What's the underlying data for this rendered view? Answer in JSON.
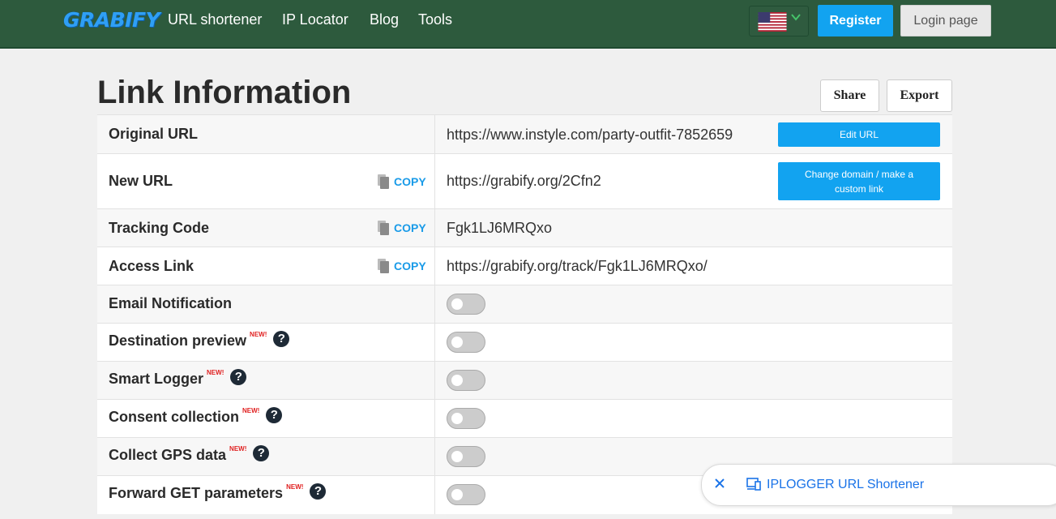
{
  "header": {
    "logo": "GRABIFY",
    "nav": [
      "URL shortener",
      "IP Locator",
      "Blog",
      "Tools"
    ],
    "language_icon": "us-flag-icon",
    "register_label": "Register",
    "login_label": "Login page"
  },
  "page": {
    "title": "Link Information",
    "share_label": "Share",
    "export_label": "Export"
  },
  "rows": [
    {
      "label": "Original URL",
      "value": "https://www.instyle.com/party-outfit-7852659",
      "action": "Edit URL"
    },
    {
      "label": "New URL",
      "copy": "COPY",
      "value": "https://grabify.org/2Cfn2",
      "action": "Change domain / make a custom link"
    },
    {
      "label": "Tracking Code",
      "copy": "COPY",
      "value": "Fgk1LJ6MRQxo"
    },
    {
      "label": "Access Link",
      "copy": "COPY",
      "value": "https://grabify.org/track/Fgk1LJ6MRQxo/"
    },
    {
      "label": "Email Notification",
      "toggle": "off"
    },
    {
      "label": "Destination preview",
      "new": "NEW!",
      "help": "?",
      "toggle": "off"
    },
    {
      "label": "Smart Logger",
      "new": "NEW!",
      "help": "?",
      "toggle": "off"
    },
    {
      "label": "Consent collection",
      "new": "NEW!",
      "help": "?",
      "toggle": "off"
    },
    {
      "label": "Collect GPS data",
      "new": "NEW!",
      "help": "?",
      "toggle": "off"
    },
    {
      "label": "Forward GET parameters",
      "new": "NEW!",
      "help": "?",
      "toggle": "off"
    }
  ],
  "toast": {
    "close_icon": "close-icon",
    "app_icon": "devices-icon",
    "text": "IPLOGGER URL Shortener"
  },
  "colors": {
    "header_bg": "#2d5a3d",
    "accent": "#12a3f0",
    "new_badge": "#e02020"
  }
}
